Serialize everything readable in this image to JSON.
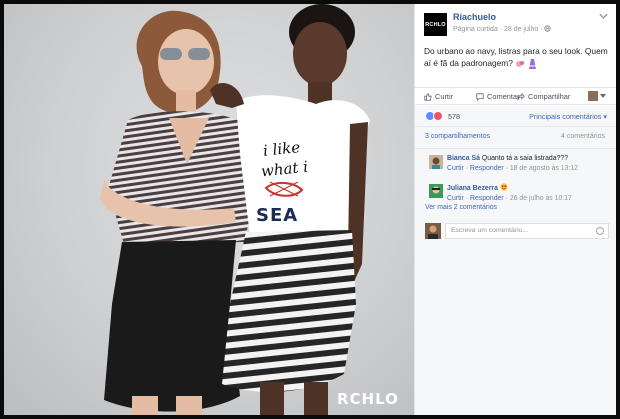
{
  "image": {
    "watermark": "RCHLO",
    "shirt_line1": "i like",
    "shirt_line2": "what i",
    "shirt_line3": "SEA"
  },
  "post": {
    "logo_text": "RCHLO",
    "page_name": "Riachuelo",
    "meta": "Página curtida · 28 de julho ·",
    "text": "Do urbano ao navy, listras para o seu look. Quem aí é fã da padronagem?"
  },
  "actions": {
    "like": "Curtir",
    "comment": "Comentar",
    "share": "Compartilhar"
  },
  "reactions": {
    "count": "578",
    "relevance": "Principais comentários ▾"
  },
  "counts": {
    "shares": "3 compartilhamentos",
    "comments": "4 comentários"
  },
  "comments": [
    {
      "name": "Bianca Sá",
      "text": "Quanto tá a saia listrada???",
      "like": "Curtir",
      "reply": "Responder",
      "time": "18 de agosto às 13:12"
    },
    {
      "name": "Juliana Bezerra",
      "text": "",
      "like": "Curtir",
      "reply": "Responder",
      "time": "26 de julho às 10:17"
    }
  ],
  "more_comments": "Ver mais 2 comentários",
  "composer": {
    "placeholder": "Escreva um comentário..."
  },
  "colors": {
    "link": "#365899",
    "accent": "#4267b2",
    "muted": "#90949c"
  }
}
